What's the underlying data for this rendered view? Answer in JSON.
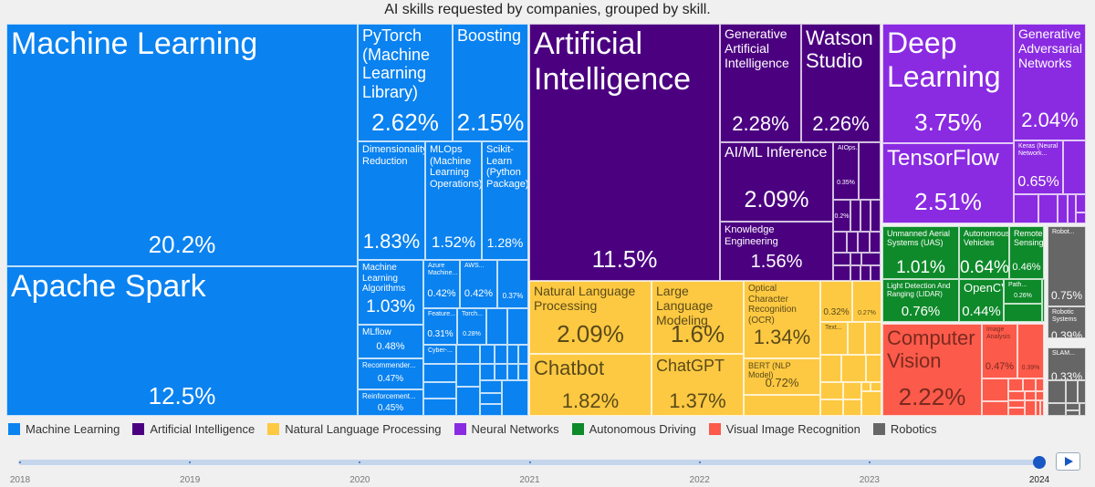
{
  "chart_data": {
    "type": "treemap",
    "title": "AI skills requested by companies, grouped by skill.",
    "groups": [
      {
        "name": "Machine Learning",
        "color": "#0a82f0",
        "text_color": "#ffffff",
        "items": [
          {
            "name": "Machine Learning",
            "value": "20.2%"
          },
          {
            "name": "Apache Spark",
            "value": "12.5%"
          },
          {
            "name": "PyTorch (Machine Learning Library)",
            "value": "2.62%"
          },
          {
            "name": "Boosting",
            "value": "2.15%"
          },
          {
            "name": "Dimensionality Reduction",
            "value": "1.83%"
          },
          {
            "name": "MLOps (Machine Learning Operations)",
            "value": "1.52%"
          },
          {
            "name": "Scikit-Learn (Python Package)",
            "value": "1.28%"
          },
          {
            "name": "Machine Learning Algorithms",
            "value": "1.03%"
          },
          {
            "name": "MLflow",
            "value": "0.48%"
          },
          {
            "name": "Recommender...",
            "value": "0.47%"
          },
          {
            "name": "Reinforcement...",
            "value": "0.45%"
          },
          {
            "name": "Azure Machine...",
            "value": "0.42%"
          },
          {
            "name": "AWS...",
            "value": "0.42%"
          },
          {
            "name": "",
            "value": "0.37%"
          },
          {
            "name": "Feature...",
            "value": "0.31%"
          },
          {
            "name": "Torch...",
            "value": "0.28%"
          },
          {
            "name": "Cyber-...",
            "value": ""
          }
        ]
      },
      {
        "name": "Artificial Intelligence",
        "color": "#4b0080",
        "text_color": "#ffffff",
        "items": [
          {
            "name": "Artificial Intelligence",
            "value": "11.5%"
          },
          {
            "name": "Generative Artificial Intelligence",
            "value": "2.28%"
          },
          {
            "name": "Watson Studio",
            "value": "2.26%"
          },
          {
            "name": "AI/ML Inference",
            "value": "2.09%"
          },
          {
            "name": "Knowledge Engineering",
            "value": "1.56%"
          },
          {
            "name": "AIOps...",
            "value": "0.35%"
          },
          {
            "name": "",
            "value": "0.2%"
          }
        ]
      },
      {
        "name": "Natural Language Processing",
        "color": "#fdc942",
        "text_color": "#5a4a1a",
        "items": [
          {
            "name": "Natural Language Processing",
            "value": "2.09%"
          },
          {
            "name": "Chatbot",
            "value": "1.82%"
          },
          {
            "name": "Large Language Modeling",
            "value": "1.6%"
          },
          {
            "name": "ChatGPT",
            "value": "1.37%"
          },
          {
            "name": "Optical Character Recognition (OCR)",
            "value": "1.34%"
          },
          {
            "name": "BERT (NLP Model)",
            "value": "0.72%"
          },
          {
            "name": "",
            "value": "0.32%"
          },
          {
            "name": "",
            "value": "0.27%"
          },
          {
            "name": "Text...",
            "value": ""
          }
        ]
      },
      {
        "name": "Neural Networks",
        "color": "#8a2be2",
        "text_color": "#ffffff",
        "items": [
          {
            "name": "Deep Learning",
            "value": "3.75%"
          },
          {
            "name": "TensorFlow",
            "value": "2.51%"
          },
          {
            "name": "Generative Adversarial Networks",
            "value": "2.04%"
          },
          {
            "name": "Keras (Neural Network...",
            "value": "0.65%"
          }
        ]
      },
      {
        "name": "Autonomous Driving",
        "color": "#0e8a2a",
        "text_color": "#ffffff",
        "items": [
          {
            "name": "Unmanned Aerial Systems (UAS)",
            "value": "1.01%"
          },
          {
            "name": "Light Detection And Ranging (LIDAR)",
            "value": "0.76%"
          },
          {
            "name": "Autonomous Vehicles",
            "value": "0.64%"
          },
          {
            "name": "Remote Sensing",
            "value": "0.46%"
          },
          {
            "name": "OpenCV",
            "value": "0.44%"
          },
          {
            "name": "Path...",
            "value": "0.26%"
          }
        ]
      },
      {
        "name": "Visual Image Recognition",
        "color": "#fc5a4a",
        "text_color": "#7a2a20",
        "items": [
          {
            "name": "Computer Vision",
            "value": "2.22%"
          },
          {
            "name": "Image Analysis",
            "value": "0.47%"
          },
          {
            "name": "",
            "value": "0.39%"
          }
        ]
      },
      {
        "name": "Robotics",
        "color": "#666666",
        "text_color": "#ffffff",
        "items": [
          {
            "name": "Robot...",
            "value": "0.75%"
          },
          {
            "name": "Robotic Systems",
            "value": "0.39%"
          },
          {
            "name": "SLAM...",
            "value": "0.33%"
          }
        ]
      }
    ],
    "legend": [
      "Machine Learning",
      "Artificial Intelligence",
      "Natural Language Processing",
      "Neural Networks",
      "Autonomous Driving",
      "Visual Image Recognition",
      "Robotics"
    ],
    "legend_placement": "bottom-left"
  },
  "timeline": {
    "years": [
      "2018",
      "2019",
      "2020",
      "2021",
      "2022",
      "2023",
      "2024"
    ],
    "selected": "2024",
    "play_label": "play"
  }
}
